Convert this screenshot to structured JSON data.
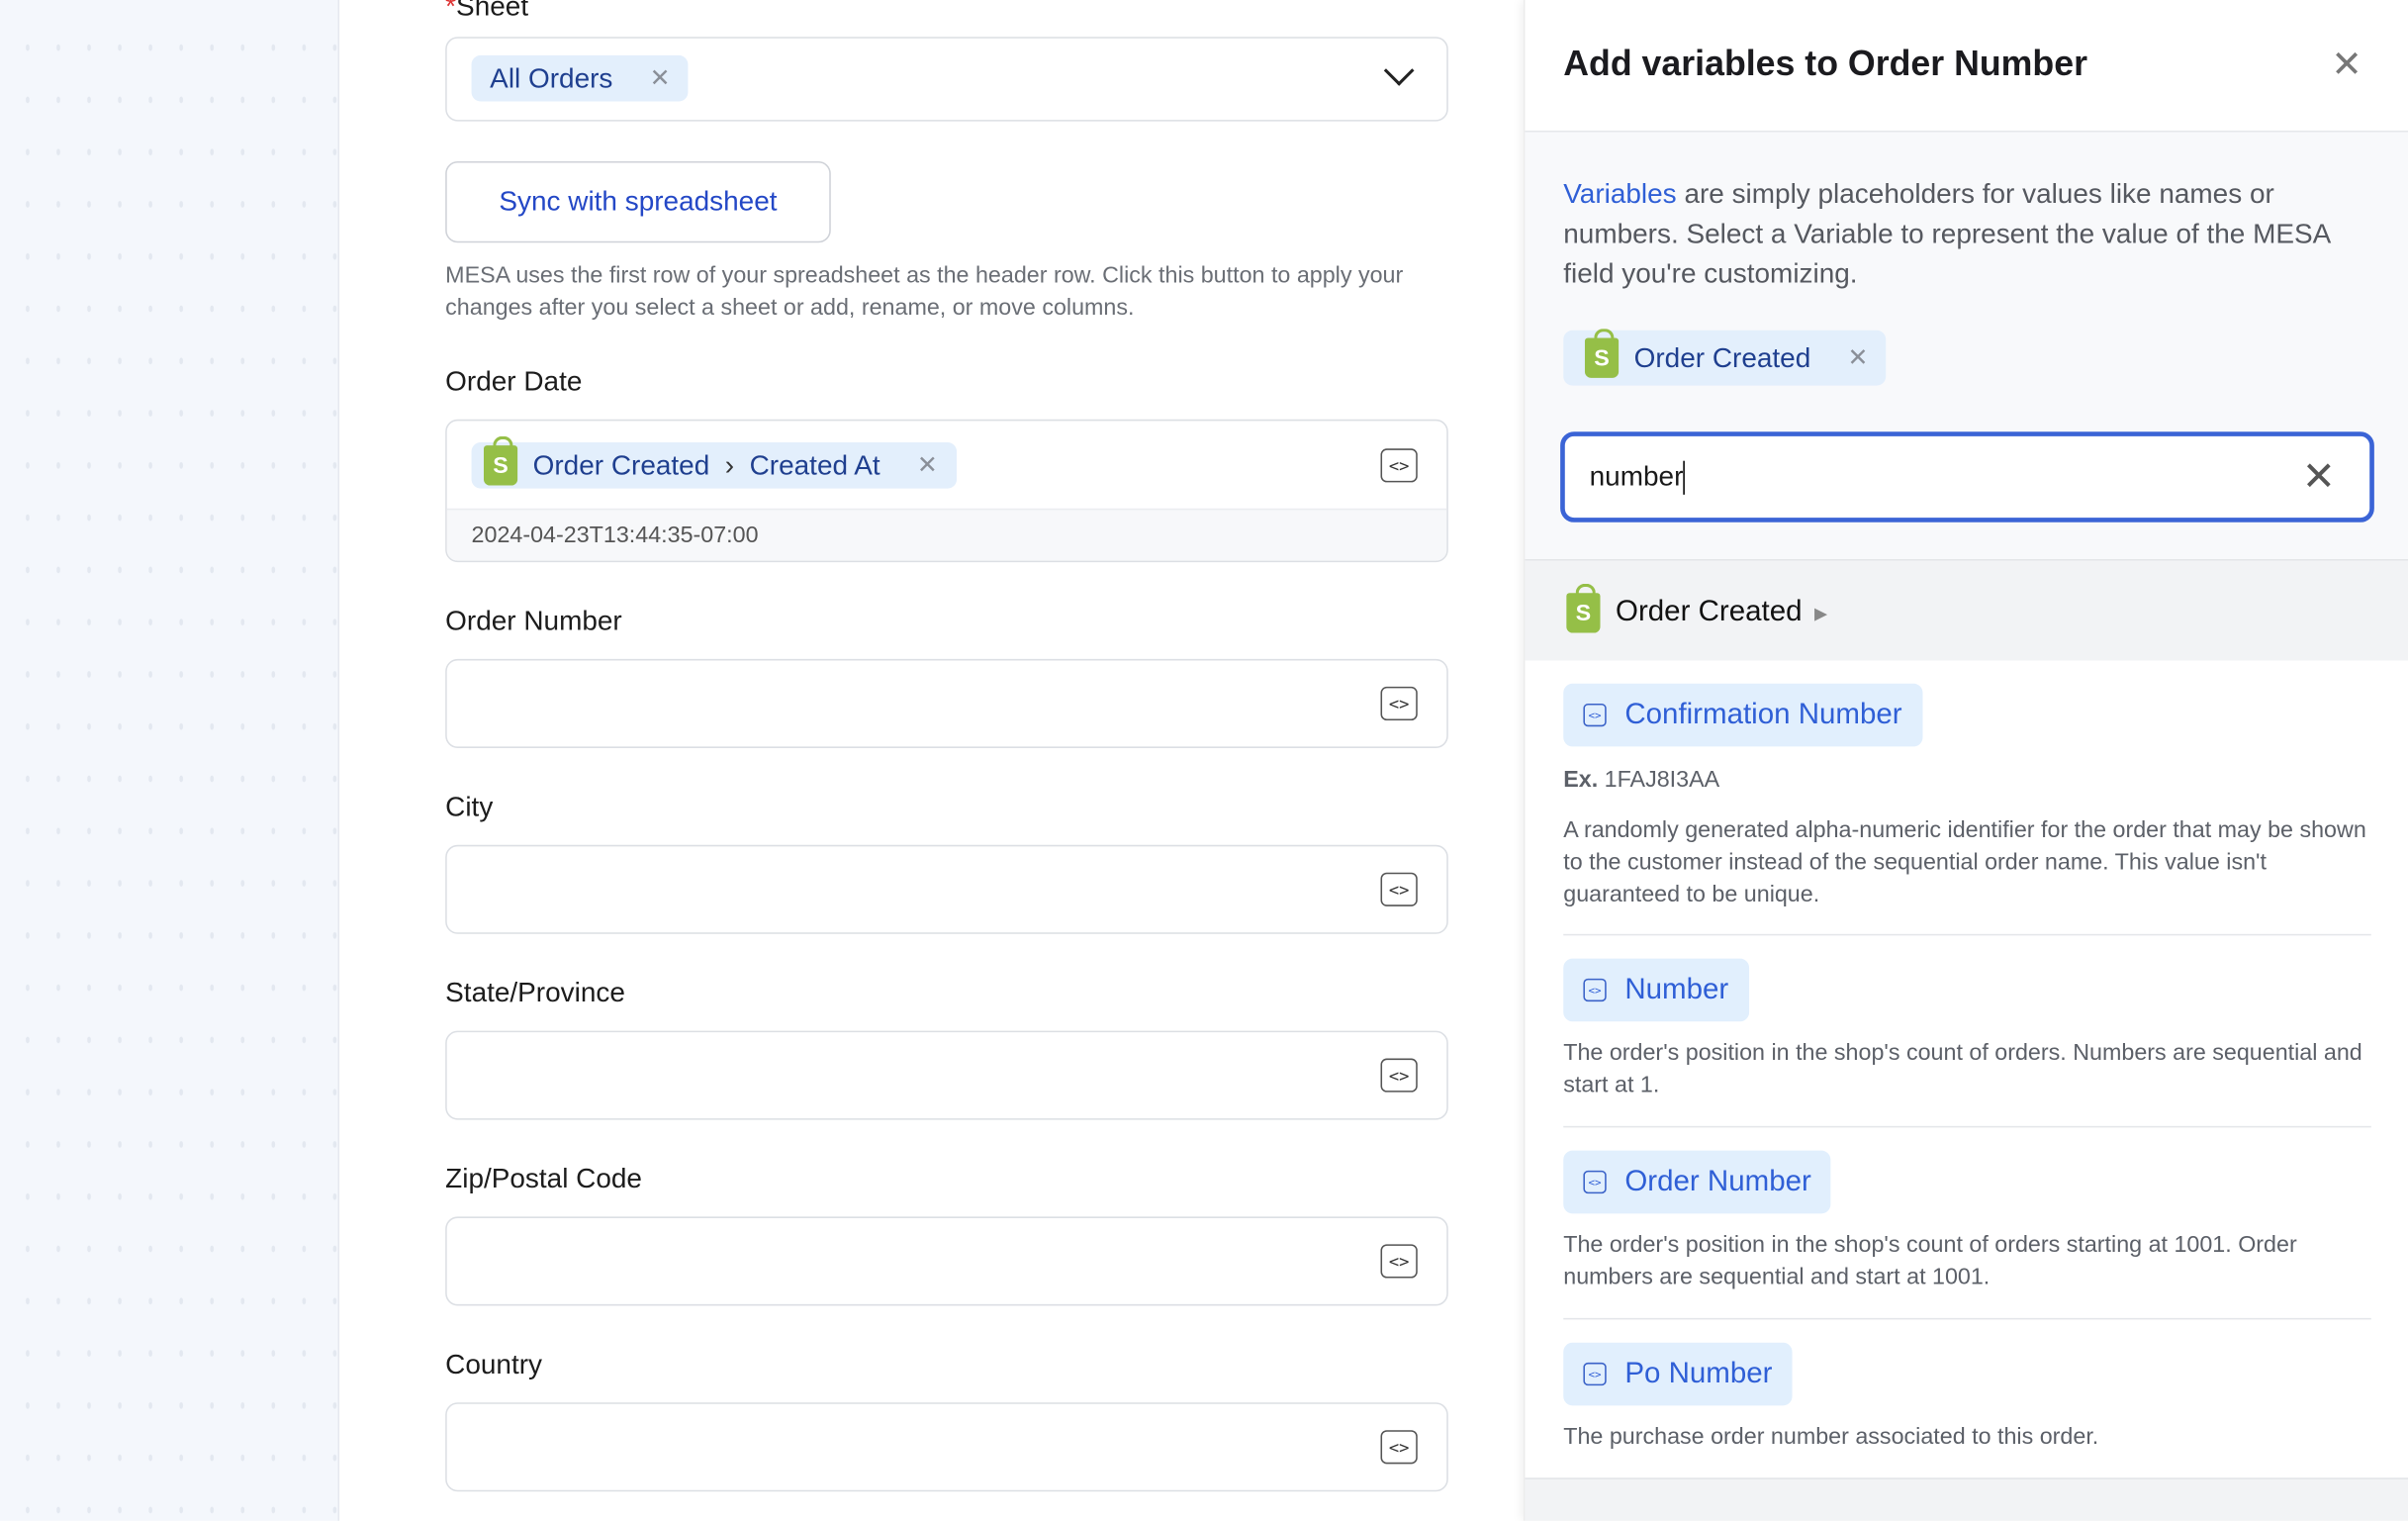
{
  "form": {
    "sheet_label": "Sheet",
    "sheet_value": "All Orders",
    "sync_button": "Sync with spreadsheet",
    "sync_help": "MESA uses the first row of your spreadsheet as the header row. Click this button to apply your changes after you select a sheet or add, rename, or move columns.",
    "fields": [
      {
        "label": "Order Date",
        "chip_source": "Order Created",
        "chip_field": "Created At",
        "preview": "2024-04-23T13:44:35-07:00"
      },
      {
        "label": "Order Number"
      },
      {
        "label": "City"
      },
      {
        "label": "State/Province"
      },
      {
        "label": "Zip/Postal Code"
      },
      {
        "label": "Country"
      }
    ]
  },
  "panel": {
    "title": "Add variables to Order Number",
    "intro_link": "Variables",
    "intro_text": " are simply placeholders for values like names or numbers. Select a Variable to represent the value of the MESA field you're customizing.",
    "filter_chip": "Order Created",
    "search_value": "number",
    "section": "Order Created",
    "variables": [
      {
        "name": "Confirmation Number",
        "example_label": "Ex.",
        "example": "1FAJ8I3AA",
        "description": "A randomly generated alpha-numeric identifier for the order that may be shown to the customer instead of the sequential order name. This value isn't guaranteed to be unique."
      },
      {
        "name": "Number",
        "description": "The order's position in the shop's count of orders. Numbers are sequential and start at 1."
      },
      {
        "name": "Order Number",
        "description": "The order's position in the shop's count of orders starting at 1001. Order numbers are sequential and start at 1001."
      },
      {
        "name": "Po Number",
        "description": "The purchase order number associated to this order."
      }
    ]
  },
  "colors": {
    "accent": "#2f5fd6",
    "chip_bg": "#e1effd",
    "focus": "#3b64d6",
    "shopify": "#95bf47"
  }
}
